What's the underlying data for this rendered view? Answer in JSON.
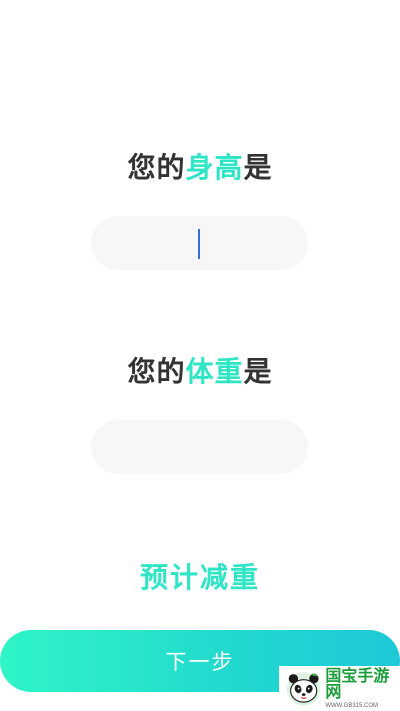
{
  "height_question": {
    "prefix": "您的",
    "highlight": "身高",
    "suffix": "是"
  },
  "height_input": {
    "value": "",
    "placeholder": ""
  },
  "weight_question": {
    "prefix": "您的",
    "highlight": "体重",
    "suffix": "是"
  },
  "weight_input": {
    "value": "",
    "placeholder": ""
  },
  "estimate_label": "预计减重",
  "next_button_label": "下一步",
  "watermark": {
    "title": "国宝手游网",
    "url": "WWW.GB315.COM",
    "icon": "panda-logo-icon"
  },
  "colors": {
    "accent": "#2ee6c5",
    "text": "#333333",
    "field_bg": "#f7f7f7",
    "button_start": "#2ff5c6",
    "button_end": "#1ec9d8"
  }
}
